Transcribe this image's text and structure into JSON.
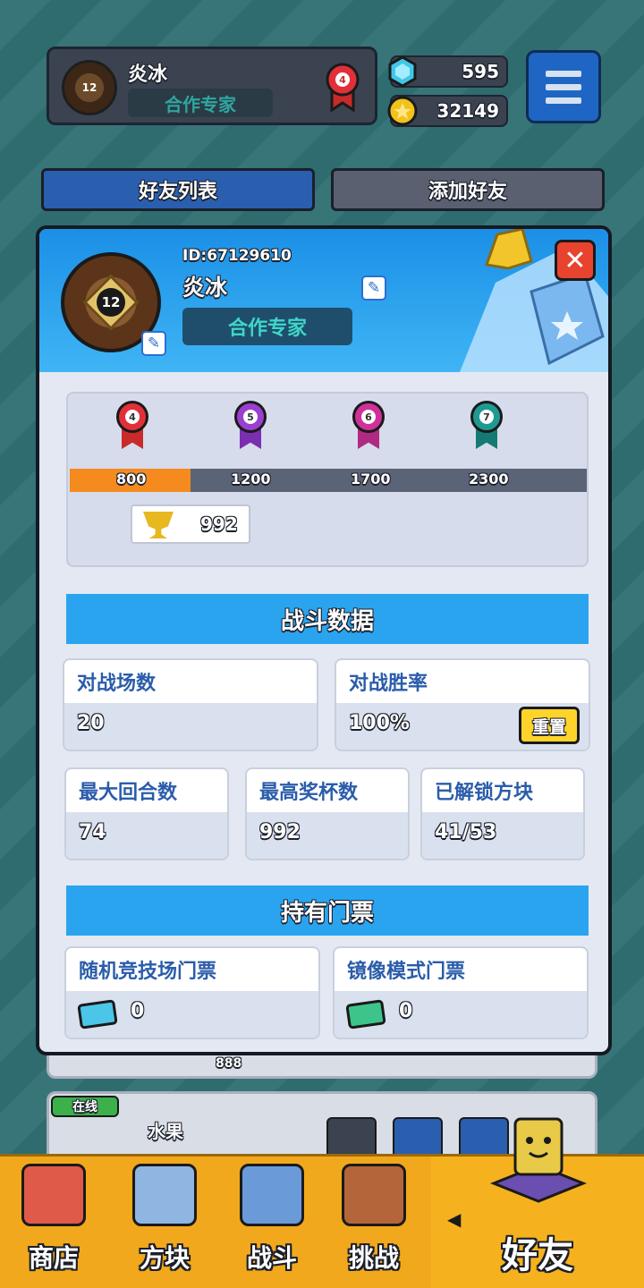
{
  "header": {
    "player_name": "炎冰",
    "player_title": "合作专家",
    "avatar_level": "12",
    "rank_badge_number": "4",
    "gems": "595",
    "coins": "32149"
  },
  "tabs": {
    "friend_list": "好友列表",
    "add_friend": "添加好友"
  },
  "modal": {
    "id_text": "ID:67129610",
    "name": "炎冰",
    "title": "合作专家",
    "avatar_level": "12",
    "close_symbol": "✕",
    "ranks": [
      {
        "number": "4",
        "threshold": "800",
        "color": "#e2303a"
      },
      {
        "number": "5",
        "threshold": "1200",
        "color": "#9a3fd0"
      },
      {
        "number": "6",
        "threshold": "1700",
        "color": "#d0309a"
      },
      {
        "number": "7",
        "threshold": "2300",
        "color": "#1f9a92"
      }
    ],
    "progress_fraction": 0.234,
    "trophies": "992",
    "battle_section_title": "战斗数据",
    "stats": {
      "battles_label": "对战场数",
      "battles_value": "20",
      "winrate_label": "对战胜率",
      "winrate_value": "100%",
      "reset_label": "重置",
      "max_rounds_label": "最大回合数",
      "max_rounds_value": "74",
      "max_trophies_label": "最高奖杯数",
      "max_trophies_value": "992",
      "unlocked_blocks_label": "已解锁方块",
      "unlocked_blocks_value": "41/53"
    },
    "tickets_section_title": "持有门票",
    "tickets": {
      "random_arena_label": "随机竞技场门票",
      "random_arena_value": "0",
      "mirror_mode_label": "镜像模式门票",
      "mirror_mode_value": "0"
    }
  },
  "background_list": {
    "online_badge": "在线",
    "friend_name": "水果",
    "partial_value": "888"
  },
  "bottom_nav": {
    "shop": "商店",
    "blocks": "方块",
    "battle": "战斗",
    "challenge": "挑战",
    "friends": "好友"
  },
  "colors": {
    "accent_blue": "#2ba4ef",
    "progress_orange": "#f58a1e",
    "nav_gold": "#f2a81c",
    "close_red": "#e8432f",
    "reset_yellow": "#ffd42a"
  }
}
